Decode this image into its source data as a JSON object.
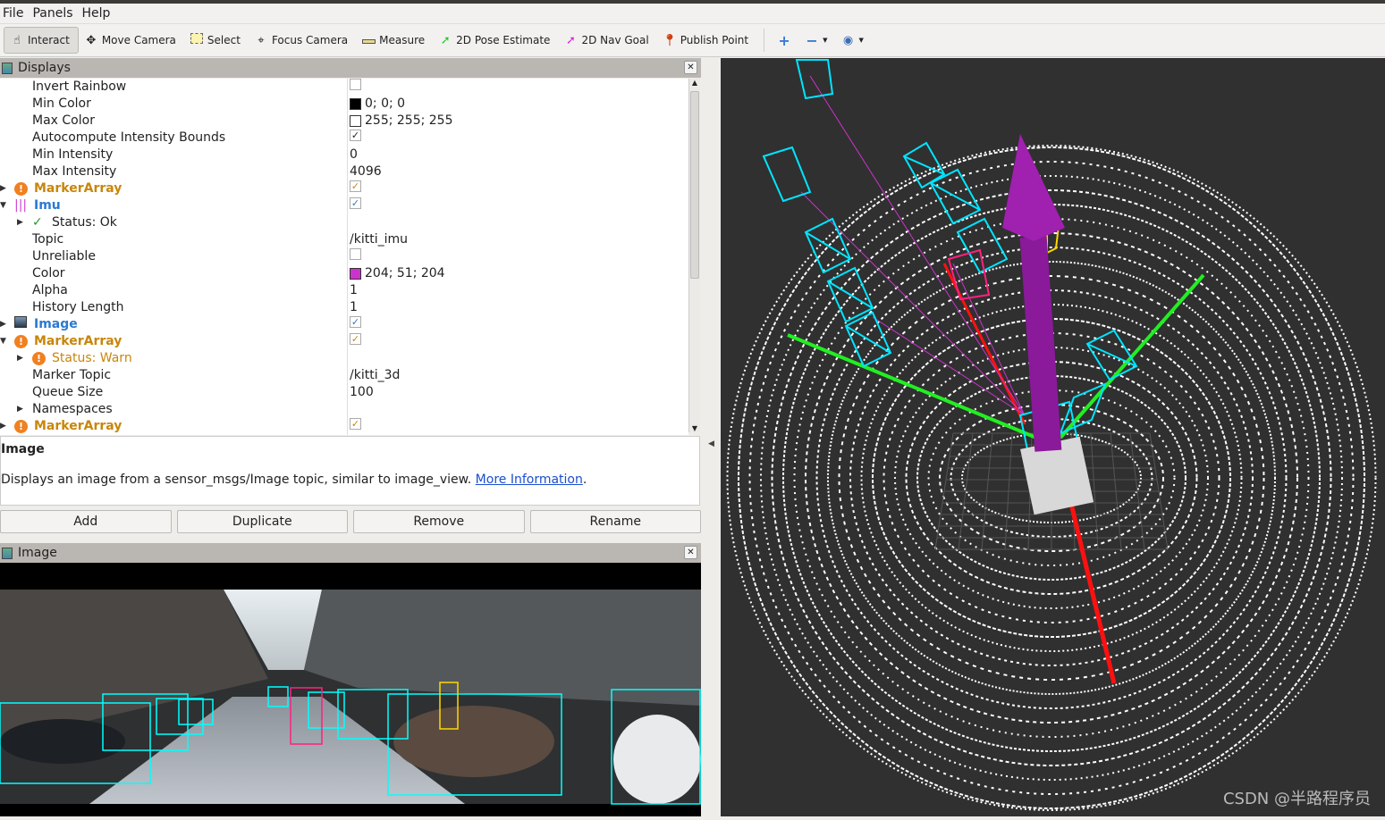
{
  "menu": [
    "File",
    "Panels",
    "Help"
  ],
  "toolbar": {
    "tools": [
      {
        "label": "Interact",
        "icon": "hand-icon",
        "active": true
      },
      {
        "label": "Move Camera",
        "icon": "move-camera-icon"
      },
      {
        "label": "Select",
        "icon": "select-icon"
      },
      {
        "label": "Focus Camera",
        "icon": "focus-camera-icon"
      },
      {
        "label": "Measure",
        "icon": "ruler-icon"
      },
      {
        "label": "2D Pose Estimate",
        "icon": "pose-arrow-icon",
        "color": "#22cc22"
      },
      {
        "label": "2D Nav Goal",
        "icon": "nav-goal-arrow-icon",
        "color": "#dd22dd"
      },
      {
        "label": "Publish Point",
        "icon": "map-pin-icon",
        "color": "#d04010"
      }
    ]
  },
  "displays": {
    "title": "Displays",
    "rows": [
      {
        "type": "prop",
        "label": "Invert Rainbow",
        "check": false
      },
      {
        "type": "prop",
        "label": "Min Color",
        "swatch": "#000000",
        "value": "0; 0; 0"
      },
      {
        "type": "prop",
        "label": "Max Color",
        "swatch": "#ffffff",
        "value": "255; 255; 255"
      },
      {
        "type": "prop",
        "label": "Autocompute Intensity Bounds",
        "check": true
      },
      {
        "type": "prop",
        "label": "Min Intensity",
        "value": "0"
      },
      {
        "type": "prop",
        "label": "Max Intensity",
        "value": "4096"
      },
      {
        "type": "cat",
        "label": "MarkerArray",
        "icon": "warning-icon",
        "color": "#c8860a",
        "check": true,
        "expanded": false
      },
      {
        "type": "cat",
        "label": "Imu",
        "icon": "imu-icon",
        "color": "#2a7ad0",
        "check": true,
        "expanded": true
      },
      {
        "type": "status",
        "label": "Status: Ok",
        "icon": "check-icon",
        "color": "#222"
      },
      {
        "type": "prop",
        "label": "Topic",
        "value": "/kitti_imu"
      },
      {
        "type": "prop",
        "label": "Unreliable",
        "check": false
      },
      {
        "type": "prop",
        "label": "Color",
        "swatch": "#cc33cc",
        "value": "204; 51; 204"
      },
      {
        "type": "prop",
        "label": "Alpha",
        "value": "1"
      },
      {
        "type": "prop",
        "label": "History Length",
        "value": "1"
      },
      {
        "type": "cat",
        "label": "Image",
        "icon": "image-icon",
        "color": "#2a7ad0",
        "check": true,
        "expanded": false
      },
      {
        "type": "cat",
        "label": "MarkerArray",
        "icon": "warning-icon",
        "color": "#c8860a",
        "check": true,
        "expanded": true
      },
      {
        "type": "status",
        "label": "Status: Warn",
        "icon": "warning-icon",
        "color": "#c8860a"
      },
      {
        "type": "prop",
        "label": "Marker Topic",
        "value": "/kitti_3d"
      },
      {
        "type": "prop",
        "label": "Queue Size",
        "value": "100"
      },
      {
        "type": "prop",
        "label": "Namespaces",
        "expandable": true
      },
      {
        "type": "cat",
        "label": "MarkerArray",
        "icon": "warning-icon",
        "color": "#c8860a",
        "check": true,
        "expanded": false
      }
    ]
  },
  "description": {
    "title": "Image",
    "text": "Displays an image from a sensor_msgs/Image topic, similar to image_view. ",
    "link": "More Information",
    "tail": "."
  },
  "buttons": [
    "Add",
    "Duplicate",
    "Remove",
    "Rename"
  ],
  "image_panel": {
    "title": "Image"
  },
  "watermark": "CSDN @半路程序员"
}
